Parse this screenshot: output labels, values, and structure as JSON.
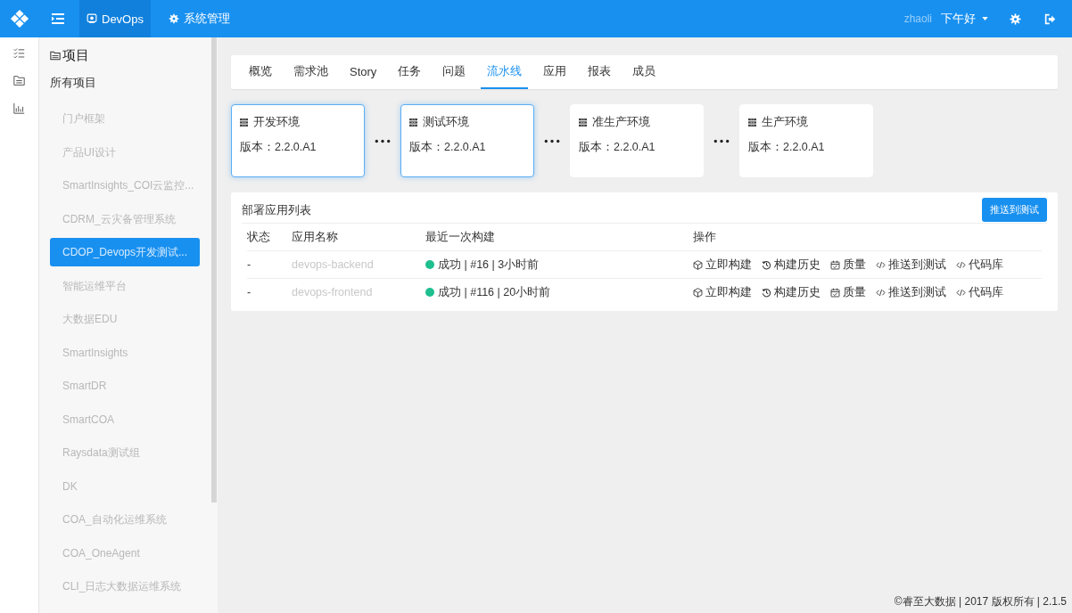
{
  "header": {
    "nav": [
      {
        "label": "DevOps",
        "selected": true,
        "kind": "monitor"
      },
      {
        "label": "系统管理",
        "selected": false,
        "kind": "gear"
      }
    ],
    "user": "zhaoli",
    "greeting": "下午好"
  },
  "rail": [
    {
      "kind": "list"
    },
    {
      "kind": "folder"
    },
    {
      "kind": "chart"
    }
  ],
  "sidebar": {
    "title": "项目",
    "all": "所有项目",
    "items": [
      {
        "label": "门户框架",
        "selected": false
      },
      {
        "label": "产品UI设计",
        "selected": false
      },
      {
        "label": "SmartInsights_COI云监控...",
        "selected": false
      },
      {
        "label": "CDRM_云灾备管理系统",
        "selected": false
      },
      {
        "label": "CDOP_Devops开发测试...",
        "selected": true
      },
      {
        "label": "智能运维平台",
        "selected": false
      },
      {
        "label": "大数据EDU",
        "selected": false
      },
      {
        "label": "SmartInsights",
        "selected": false
      },
      {
        "label": "SmartDR",
        "selected": false
      },
      {
        "label": "SmartCOA",
        "selected": false
      },
      {
        "label": "Raysdata测试组",
        "selected": false
      },
      {
        "label": "DK",
        "selected": false
      },
      {
        "label": "COA_自动化运维系统",
        "selected": false
      },
      {
        "label": "COA_OneAgent",
        "selected": false
      },
      {
        "label": "CLI_日志大数据运维系统",
        "selected": false
      }
    ]
  },
  "tabs": [
    {
      "label": "概览",
      "selected": false
    },
    {
      "label": "需求池",
      "selected": false
    },
    {
      "label": "Story",
      "selected": false
    },
    {
      "label": "任务",
      "selected": false
    },
    {
      "label": "问题",
      "selected": false
    },
    {
      "label": "流水线",
      "selected": true
    },
    {
      "label": "应用",
      "selected": false
    },
    {
      "label": "报表",
      "selected": false
    },
    {
      "label": "成员",
      "selected": false
    }
  ],
  "environments": [
    {
      "name": "开发环境",
      "version": "版本：2.2.0.A1",
      "selected": true
    },
    {
      "name": "测试环境",
      "version": "版本：2.2.0.A1",
      "selected": true
    },
    {
      "name": "准生产环境",
      "version": "版本：2.2.0.A1",
      "selected": false
    },
    {
      "name": "生产环境",
      "version": "版本：2.2.0.A1",
      "selected": false
    }
  ],
  "table": {
    "title": "部署应用列表",
    "button": "推送到测试",
    "columns": [
      "状态",
      "应用名称",
      "最近一次构建",
      "操作"
    ],
    "rows": [
      {
        "status": "-",
        "name": "devops-backend",
        "build": "成功 | #16 | 3小时前",
        "color": "#1fbf8f",
        "actions": [
          {
            "kind": "cube",
            "label": "立即构建"
          },
          {
            "kind": "history",
            "label": "构建历史"
          },
          {
            "kind": "calendar",
            "label": "质量"
          },
          {
            "kind": "code",
            "label": "推送到测试"
          },
          {
            "kind": "code",
            "label": "代码库"
          }
        ]
      },
      {
        "status": "-",
        "name": "devops-frontend",
        "build": "成功 | #116 | 20小时前",
        "color": "#1fbf8f",
        "actions": [
          {
            "kind": "cube",
            "label": "立即构建"
          },
          {
            "kind": "history",
            "label": "构建历史"
          },
          {
            "kind": "calendar",
            "label": "质量"
          },
          {
            "kind": "code",
            "label": "推送到测试"
          },
          {
            "kind": "code",
            "label": "代码库"
          }
        ]
      }
    ]
  },
  "footer": "©睿至大数据 | 2017 版权所有 | 2.1.5"
}
